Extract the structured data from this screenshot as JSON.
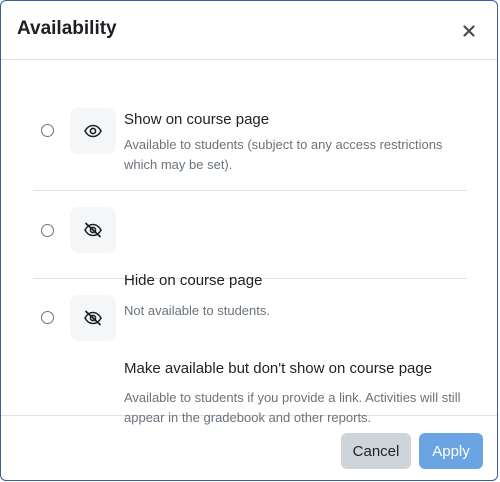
{
  "dialog": {
    "title": "Availability",
    "close_icon": "close-icon"
  },
  "options": [
    {
      "title": "Show on course page",
      "description": "Available to students (subject to any access restrictions which may be set).",
      "icon": "eye-icon",
      "selected": false
    },
    {
      "title": "Hide on course page",
      "description": "Not available to students.",
      "icon": "eye-slash-icon",
      "selected": false
    },
    {
      "title": "Make available but don't show on course page",
      "description": "Available to students if you provide a link. Activities will still appear in the gradebook and other reports.",
      "icon": "eye-slash-icon",
      "selected": false
    }
  ],
  "footer": {
    "cancel_label": "Cancel",
    "apply_label": "Apply"
  },
  "colors": {
    "accent": "#6ba4e3",
    "secondary_button": "#ced4da",
    "muted_text": "#6a737b",
    "border": "#3a5f9c"
  }
}
